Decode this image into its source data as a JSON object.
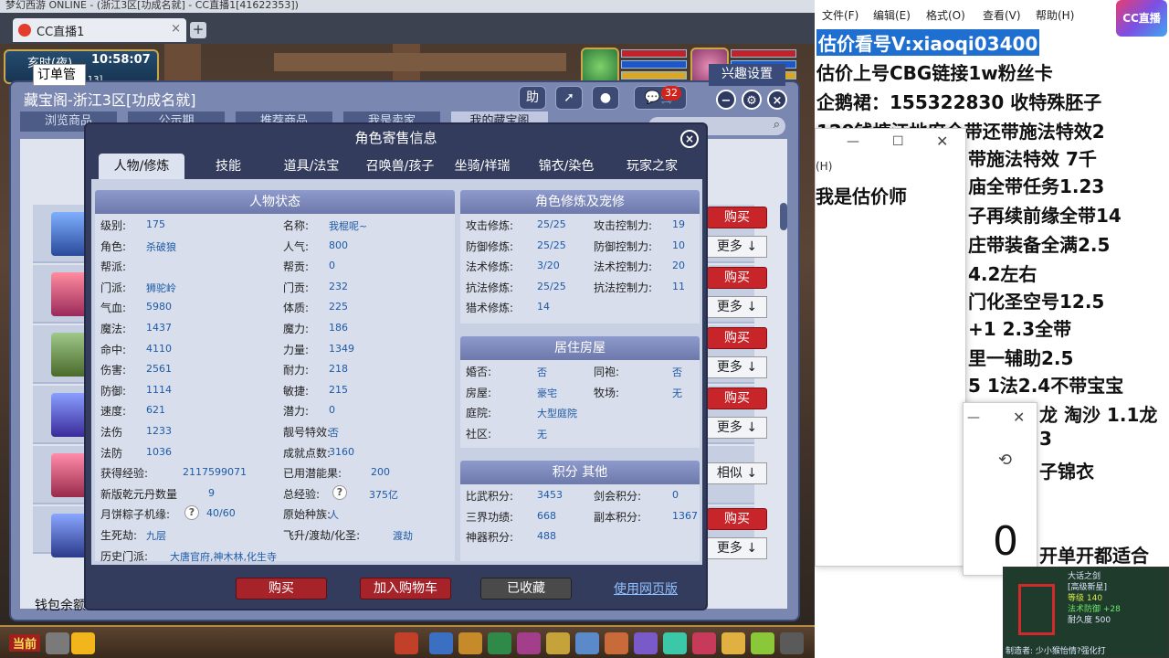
{
  "browser": {
    "window_title": "梦幻西游 ONLINE - (浙江3区[功成名就] - CC直播1[41622353])",
    "tab_label": "CC直播1",
    "tab_close": "×",
    "new_tab": "+"
  },
  "game": {
    "time_period": "亥时(夜)",
    "clock": "10:58:07",
    "location": "程咬金府[21,13]",
    "current_label": "当前"
  },
  "market": {
    "title": "藏宝阁-浙江3区[功成名就]",
    "help_label": "助",
    "cart_count": "32",
    "tabs": [
      "浏览商品",
      "公示期",
      "推荐商品",
      "我是卖家",
      "我的藏宝阁"
    ],
    "order_label": "订单管",
    "interest_label": "兴趣设置",
    "buy_label": "购买",
    "more_label": "更多",
    "similar_label": "相似",
    "wallet_label": "钱包余额"
  },
  "dialog": {
    "title": "角色寄售信息",
    "close": "×",
    "tabs": [
      "人物/修炼",
      "技能",
      "道具/法宝",
      "召唤兽/孩子",
      "坐骑/祥瑞",
      "锦衣/染色",
      "玩家之家"
    ],
    "status_head": "人物状态",
    "left_col": [
      {
        "label": "级别:",
        "value": "175"
      },
      {
        "label": "角色:",
        "value": "杀破狼"
      },
      {
        "label": "帮派:",
        "value": ""
      },
      {
        "label": "门派:",
        "value": "狮驼岭"
      },
      {
        "label": "气血:",
        "value": "5980"
      },
      {
        "label": "魔法:",
        "value": "1437"
      },
      {
        "label": "命中:",
        "value": "4110"
      },
      {
        "label": "伤害:",
        "value": "2561"
      },
      {
        "label": "防御:",
        "value": "1114"
      },
      {
        "label": "速度:",
        "value": "621"
      },
      {
        "label": "法伤",
        "value": "1233"
      },
      {
        "label": "法防",
        "value": "1036"
      },
      {
        "label": "获得经验:",
        "value": "2117599071"
      },
      {
        "label": "新版乾元丹数量",
        "value": "9"
      },
      {
        "label": "月饼粽子机缘:",
        "value": "40/60"
      },
      {
        "label": "生死劫:",
        "value": "九层"
      },
      {
        "label": "历史门派:",
        "value": "大唐官府,神木林,化生寺"
      }
    ],
    "mid_col": [
      {
        "label": "名称:",
        "value": "我棍呢~"
      },
      {
        "label": "人气:",
        "value": "800"
      },
      {
        "label": "帮贡:",
        "value": "0"
      },
      {
        "label": "门贡:",
        "value": "232"
      },
      {
        "label": "体质:",
        "value": "225"
      },
      {
        "label": "魔力:",
        "value": "186"
      },
      {
        "label": "力量:",
        "value": "1349"
      },
      {
        "label": "耐力:",
        "value": "218"
      },
      {
        "label": "敏捷:",
        "value": "215"
      },
      {
        "label": "潜力:",
        "value": "0"
      },
      {
        "label": "靓号特效:",
        "value": "否"
      },
      {
        "label": "成就点数:",
        "value": "3160"
      },
      {
        "label": "已用潜能果:",
        "value": "200"
      },
      {
        "label": "总经验:",
        "value": "375亿"
      },
      {
        "label": "原始种族:",
        "value": "人"
      },
      {
        "label": "飞升/渡劫/化圣:",
        "value": "渡劫"
      }
    ],
    "cultivation_head": "角色修炼及宠修",
    "cultivation": [
      {
        "label": "攻击修炼:",
        "value": "25/25",
        "label2": "攻击控制力:",
        "value2": "19"
      },
      {
        "label": "防御修炼:",
        "value": "25/25",
        "label2": "防御控制力:",
        "value2": "10"
      },
      {
        "label": "法术修炼:",
        "value": "3/20",
        "label2": "法术控制力:",
        "value2": "20"
      },
      {
        "label": "抗法修炼:",
        "value": "25/25",
        "label2": "抗法控制力:",
        "value2": "11"
      },
      {
        "label": "猎术修炼:",
        "value": "14",
        "label2": "",
        "value2": ""
      }
    ],
    "house_head": "居住房屋",
    "house": [
      {
        "label": "婚否:",
        "value": "否",
        "label2": "同袍:",
        "value2": "否"
      },
      {
        "label": "房屋:",
        "value": "豪宅",
        "label2": "牧场:",
        "value2": "无"
      },
      {
        "label": "庭院:",
        "value": "大型庭院",
        "label2": "",
        "value2": ""
      },
      {
        "label": "社区:",
        "value": "无",
        "label2": "",
        "value2": ""
      }
    ],
    "points_head": "积分 其他",
    "points": [
      {
        "label": "比武积分:",
        "value": "3453",
        "label2": "剑会积分:",
        "value2": "0"
      },
      {
        "label": "三界功绩:",
        "value": "668",
        "label2": "副本积分:",
        "value2": "1367"
      },
      {
        "label": "神器积分:",
        "value": "488",
        "label2": "",
        "value2": ""
      }
    ],
    "qmark": "?",
    "buy_button": "购买",
    "add_cart_button": "加入购物车",
    "favorited_button": "已收藏",
    "web_link": "使用网页版"
  },
  "notepad": {
    "menu": [
      "文件(F)",
      "编辑(E)",
      "格式(O)",
      "查看(V)",
      "帮助(H)"
    ],
    "logo": "CC直播",
    "lines": [
      "估价看号V:xiaoqi03400",
      "估价上号CBG链接1w粉丝卡",
      "企鹅裙：155322830 收特殊胚子",
      "129钱塘江地府全带还带施法特效2",
      "带施法特效 7千",
      "庙全带任务1.23",
      "子再续前缘全带14",
      "庄带装备全满2.5",
      "4.2左右",
      "门化圣空号12.5",
      "+1 2.3全带",
      "里一辅助2.5",
      "5 1法2.4不带宝宝",
      "龙 淘沙 1.1龙",
      "3",
      "子锦衣",
      "开单开都适合"
    ],
    "popup_menu": "(H)",
    "popup_text": "我是估价师",
    "counter": "0",
    "thumb_lines": [
      "大话之剑",
      "[高级新星]",
      "等级 140",
      "法术防御 +28",
      "耐久度 500",
      "制造者: 少小猴怡情?强化打"
    ]
  }
}
